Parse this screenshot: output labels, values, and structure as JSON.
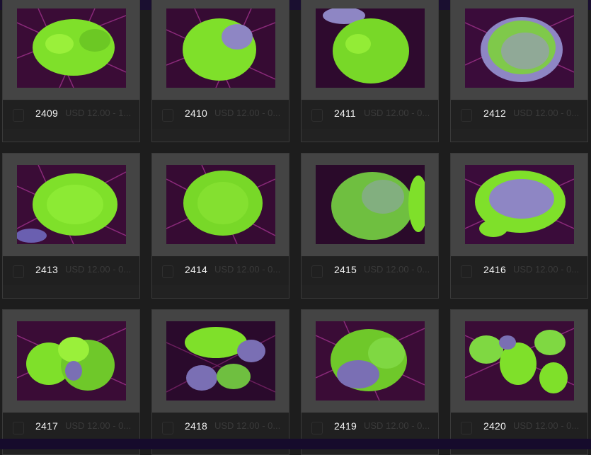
{
  "products": [
    {
      "id": "2409",
      "price": "USD 12.00 - 1..."
    },
    {
      "id": "2410",
      "price": "USD 12.00 - 0..."
    },
    {
      "id": "2411",
      "price": "USD 12.00 - 0..."
    },
    {
      "id": "2412",
      "price": "USD 12.00 - 0..."
    },
    {
      "id": "2413",
      "price": "USD 12.00 - 0..."
    },
    {
      "id": "2414",
      "price": "USD 12.00 - 0..."
    },
    {
      "id": "2415",
      "price": "USD 12.00 - 0..."
    },
    {
      "id": "2416",
      "price": "USD 12.00 - 0..."
    },
    {
      "id": "2417",
      "price": "USD 12.00 - 0..."
    },
    {
      "id": "2418",
      "price": "USD 12.00 - 0..."
    },
    {
      "id": "2419",
      "price": "USD 12.00 - 0..."
    },
    {
      "id": "2420",
      "price": "USD 12.00 - 0..."
    }
  ],
  "colors": {
    "page_bg": "#1d1d1d",
    "frame_bg": "#444444",
    "coral_green": "#7fe02a",
    "coral_violet": "#8e86c4",
    "tank_magenta": "#5a1450",
    "top_bar": "#1a0f30"
  }
}
